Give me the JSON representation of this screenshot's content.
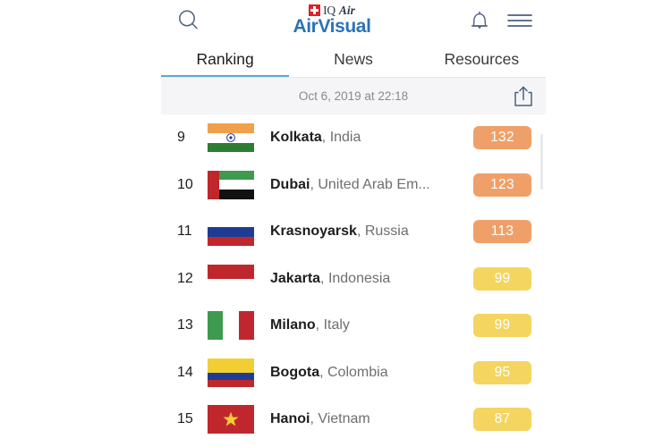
{
  "app": {
    "logo": {
      "mark": "swiss-cross",
      "brand_small_1": "IQ",
      "brand_small_2": "Air",
      "brand_large": "AirVisual"
    },
    "topbar": {
      "search_icon": "search-icon",
      "bell_icon": "bell-icon",
      "menu_icon": "hamburger-menu-icon"
    },
    "tabs": [
      {
        "label": "Ranking",
        "active": true
      },
      {
        "label": "News",
        "active": false
      },
      {
        "label": "Resources",
        "active": false
      }
    ],
    "datebar": {
      "timestamp": "Oct 6, 2019 at 22:18",
      "share_icon": "share-icon"
    },
    "colors": {
      "accent_blue": "#2C72B8",
      "tab_underline": "#5EA9CE",
      "aqi_orange": "#EFA069",
      "aqi_yellow": "#F4D55F",
      "swiss_red": "#D8232A",
      "datebar_bg": "#F5F5F7"
    },
    "ranking": [
      {
        "rank": "9",
        "city": "Kolkata",
        "country": ", India",
        "aqi": "132",
        "level": "orange",
        "flag": "in",
        "truncated": false
      },
      {
        "rank": "10",
        "city": "Dubai",
        "country": ", United Arab Em...",
        "aqi": "123",
        "level": "orange",
        "flag": "ae",
        "truncated": true
      },
      {
        "rank": "11",
        "city": "Krasnoyarsk",
        "country": ", Russia",
        "aqi": "113",
        "level": "orange",
        "flag": "ru",
        "truncated": false
      },
      {
        "rank": "12",
        "city": "Jakarta",
        "country": ", Indonesia",
        "aqi": "99",
        "level": "yellow",
        "flag": "id",
        "truncated": false
      },
      {
        "rank": "13",
        "city": "Milano",
        "country": ", Italy",
        "aqi": "99",
        "level": "yellow",
        "flag": "it",
        "truncated": false
      },
      {
        "rank": "14",
        "city": "Bogota",
        "country": ", Colombia",
        "aqi": "95",
        "level": "yellow",
        "flag": "co",
        "truncated": false
      },
      {
        "rank": "15",
        "city": "Hanoi",
        "country": ", Vietnam",
        "aqi": "87",
        "level": "yellow",
        "flag": "vn",
        "truncated": false
      }
    ]
  }
}
